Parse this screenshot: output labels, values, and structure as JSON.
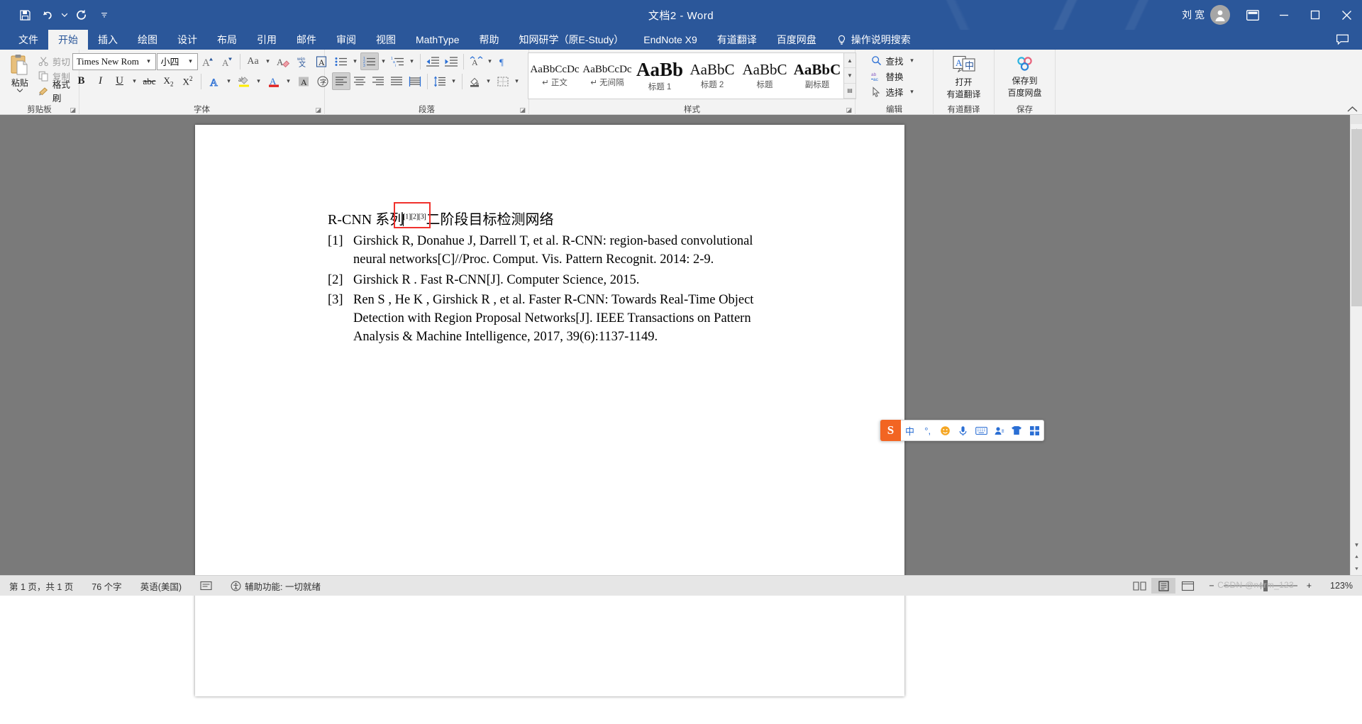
{
  "window": {
    "title": "文档2  -  Word",
    "user_name": "刘 宽",
    "quick_access": [
      {
        "name": "save",
        "icon": "save-icon"
      },
      {
        "name": "undo",
        "icon": "undo-icon"
      },
      {
        "name": "redo",
        "icon": "redo-icon"
      },
      {
        "name": "customize",
        "icon": "customize-qat-icon"
      }
    ],
    "buttons": {
      "ribbon_display": "ribbon-display-options-icon",
      "minimize": "minimize-icon",
      "restore": "restore-icon",
      "close": "close-icon"
    }
  },
  "tabs": [
    {
      "label": "文件",
      "active": false
    },
    {
      "label": "开始",
      "active": true
    },
    {
      "label": "插入",
      "active": false
    },
    {
      "label": "绘图",
      "active": false
    },
    {
      "label": "设计",
      "active": false
    },
    {
      "label": "布局",
      "active": false
    },
    {
      "label": "引用",
      "active": false
    },
    {
      "label": "邮件",
      "active": false
    },
    {
      "label": "审阅",
      "active": false
    },
    {
      "label": "视图",
      "active": false
    },
    {
      "label": "MathType",
      "active": false
    },
    {
      "label": "帮助",
      "active": false
    },
    {
      "label": "知网研学（原E-Study）",
      "active": false
    },
    {
      "label": "EndNote X9",
      "active": false
    },
    {
      "label": "有道翻译",
      "active": false
    },
    {
      "label": "百度网盘",
      "active": false
    }
  ],
  "tellme": {
    "placeholder": "操作说明搜索",
    "icon": "lightbulb-icon"
  },
  "ribbon": {
    "clipboard": {
      "label": "剪贴板",
      "paste": "粘贴",
      "cut": "剪切",
      "copy": "复制",
      "format_painter": "格式刷"
    },
    "font": {
      "label": "字体",
      "font_name": "Times New Rom",
      "font_size": "小四",
      "buttons": {
        "grow": "A",
        "shrink": "A",
        "change_case": "Aa",
        "clear_formatting": "clear-formatting-icon",
        "phonetic_guide": "phonetic-guide-icon",
        "character_border": "A",
        "bold": "B",
        "italic": "I",
        "underline": "U",
        "strikethrough": "abc",
        "subscript": "X₂",
        "superscript": "X²",
        "text_effects": "A",
        "highlight": "ab",
        "font_color": "A",
        "character_shading": "A",
        "enclose_characters": "字"
      }
    },
    "paragraph": {
      "label": "段落",
      "buttons": {
        "bullets": "bullets-icon",
        "numbering": "numbering-icon",
        "multilevel_list": "multilevel-list-icon",
        "decrease_indent": "decrease-indent-icon",
        "increase_indent": "increase-indent-icon",
        "sort": "sort-icon",
        "show_marks": "show-formatting-marks-icon",
        "align_left": "align-left-icon",
        "align_center": "align-center-icon",
        "align_right": "align-right-icon",
        "justify": "justify-icon",
        "distribute": "distribute-icon",
        "line_spacing": "line-spacing-icon",
        "shading": "shading-icon",
        "borders": "borders-icon"
      },
      "active": [
        "numbering",
        "align_left"
      ]
    },
    "styles": {
      "label": "样式",
      "items": [
        {
          "preview": "AaBbCcDc",
          "name": "正文",
          "mark": "↵",
          "size": 15,
          "bold": false
        },
        {
          "preview": "AaBbCcDc",
          "name": "无间隔",
          "mark": "↵",
          "size": 15,
          "bold": false
        },
        {
          "preview": "AaBb",
          "name": "标题 1",
          "mark": "",
          "size": 27,
          "bold": true
        },
        {
          "preview": "AaBbC",
          "name": "标题 2",
          "mark": "",
          "size": 21,
          "bold": false
        },
        {
          "preview": "AaBbC",
          "name": "标题",
          "mark": "",
          "size": 21,
          "bold": false
        },
        {
          "preview": "AaBbC",
          "name": "副标题",
          "mark": "",
          "size": 21,
          "bold": true
        }
      ]
    },
    "editing": {
      "label": "编辑",
      "find": "查找",
      "replace": "替换",
      "select": "选择"
    },
    "youdao": {
      "label": "有道翻译",
      "button_line1": "打开",
      "button_line2": "有道翻译",
      "icon": "translate-icon"
    },
    "baidu": {
      "label": "保存",
      "button_line1": "保存到",
      "button_line2": "百度网盘",
      "icon": "baidu-netdisk-icon"
    },
    "collapse_icon": "collapse-ribbon-icon"
  },
  "document": {
    "heading": {
      "before": "R-CNN 系列",
      "citations": "[1][2][3]",
      "after": "二阶段目标检测网络"
    },
    "references": [
      {
        "num": "[1]",
        "lines": [
          "Girshick R, Donahue J, Darrell T, et al. R-CNN: region-based convolutional",
          "neural networks[C]//Proc. Comput. Vis. Pattern Recognit. 2014: 2-9."
        ]
      },
      {
        "num": "[2]",
        "lines": [
          "Girshick R . Fast R-CNN[J]. Computer Science, 2015."
        ]
      },
      {
        "num": "[3]",
        "lines": [
          "Ren S ,    He K ,    Girshick R , et al. Faster R-CNN: Towards Real-Time Object",
          "Detection with Region Proposal Networks[J]. IEEE Transactions on Pattern",
          "Analysis & Machine Intelligence, 2017, 39(6):1137-1149."
        ]
      }
    ]
  },
  "ime": {
    "logo": "S",
    "items": [
      {
        "name": "chinese-mode",
        "glyph": "中"
      },
      {
        "name": "punctuation-mode",
        "glyph": "°,"
      },
      {
        "name": "emoji",
        "glyph": "☺"
      },
      {
        "name": "voice-input",
        "glyph": "🎤"
      },
      {
        "name": "soft-keyboard",
        "glyph": "⌨"
      },
      {
        "name": "user-center",
        "glyph": "👤"
      },
      {
        "name": "skin",
        "glyph": "👕"
      },
      {
        "name": "toolbox",
        "glyph": "⊞"
      }
    ]
  },
  "statusbar": {
    "page_info": "第 1 页，共 1 页",
    "word_count": "76 个字",
    "language": "英语(美国)",
    "proofing_icon": "proofing-icon",
    "accessibility": "辅助功能: 一切就绪",
    "views": [
      {
        "name": "read-mode",
        "icon": "read-mode-icon",
        "active": false
      },
      {
        "name": "print-layout",
        "icon": "print-layout-icon",
        "active": true
      },
      {
        "name": "web-layout",
        "icon": "web-layout-icon",
        "active": false
      }
    ],
    "zoom_out": "−",
    "zoom_in": "+",
    "zoom_level": "123%"
  },
  "watermark": "CSDN @nerm_123"
}
